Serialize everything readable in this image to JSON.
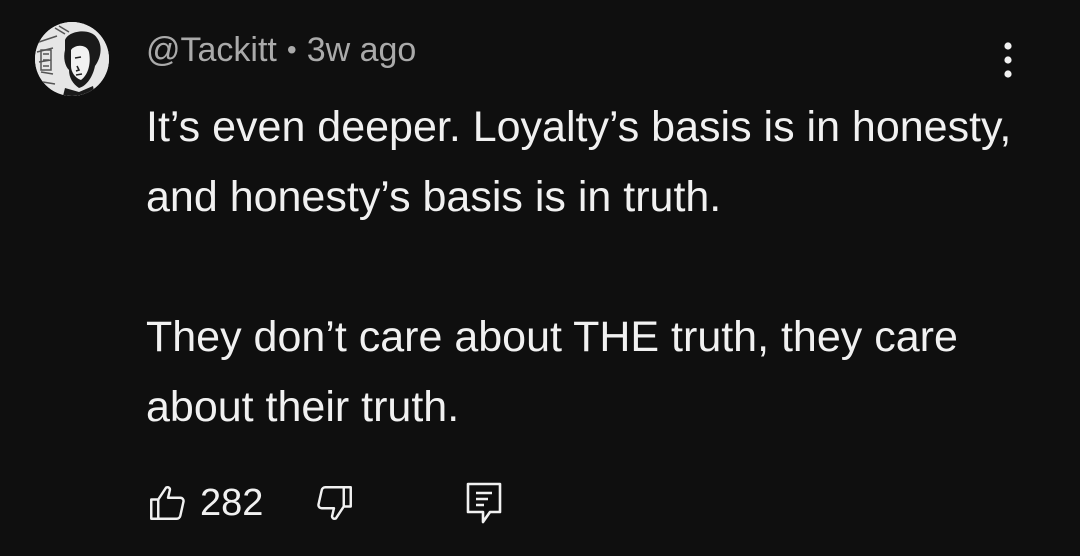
{
  "comment": {
    "author": "@Tackitt",
    "separator": "•",
    "time": "3w ago",
    "paragraphs": [
      "It’s even deeper. Loyalty’s basis is in honesty, and honesty’s basis is in truth.",
      "They don’t care about THE truth, they care about their truth."
    ],
    "likes": "282",
    "avatar_icon": "user-avatar",
    "more_icon": "more-vert-icon",
    "like_icon": "thumbs-up-icon",
    "dislike_icon": "thumbs-down-icon",
    "reply_icon": "reply-comment-icon"
  },
  "colors": {
    "background": "#0f0f0f",
    "text_primary": "#f1f1f1",
    "text_secondary": "#aaaaaa"
  }
}
